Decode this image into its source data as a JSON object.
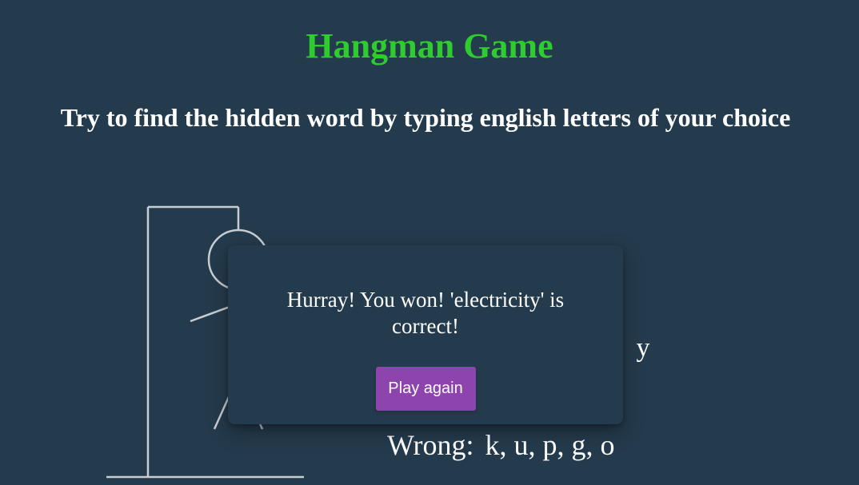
{
  "header": {
    "title": "Hangman Game",
    "subtitle": "Try to find the hidden word by typing english letters of your choice"
  },
  "word": {
    "letters": [
      "e",
      "l",
      "e",
      "c",
      "t",
      "r",
      "i",
      "c",
      "i",
      "t",
      "y"
    ]
  },
  "wrong": {
    "label": "Wrong:",
    "letters": "k, u, p, g, o"
  },
  "popup": {
    "message": "Hurray! You won! 'electricity' is correct!",
    "button_label": "Play again"
  },
  "colors": {
    "background": "#243b4d",
    "title": "#2ecc2e",
    "button": "#8e44ad",
    "figure": "#c7cdd2"
  }
}
